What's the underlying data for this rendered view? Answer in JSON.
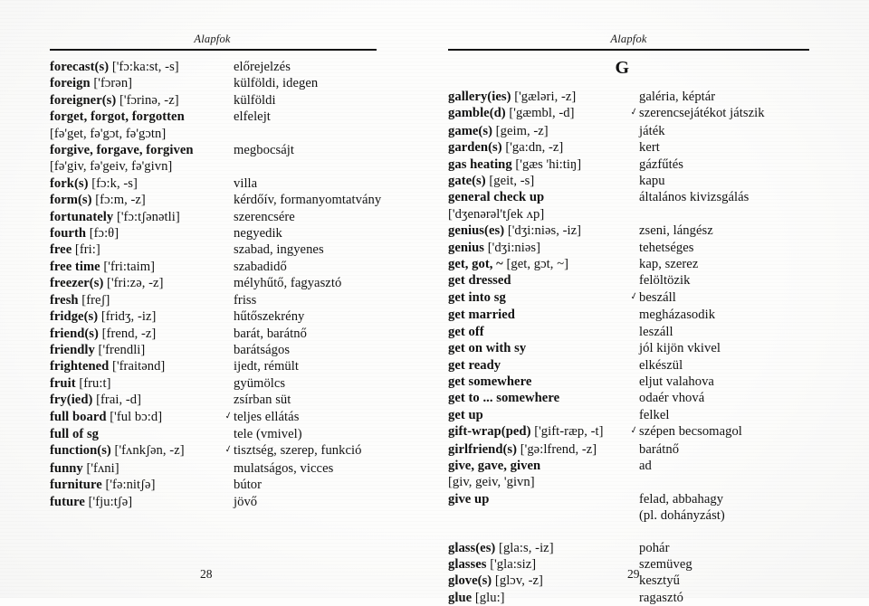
{
  "book": {
    "running_head": "Alapfok"
  },
  "left_page": {
    "running_head": "Alapfok",
    "folio": "28",
    "entries": [
      {
        "headword": "forecast(s)",
        "ipa": "['fɔ:ka:st, -s]",
        "gloss": "előrejelzés",
        "mark": ""
      },
      {
        "headword": "foreign",
        "ipa": "['fɔrən]",
        "gloss": "külföldi, idegen",
        "mark": ""
      },
      {
        "headword": "foreigner(s)",
        "ipa": "['fɔrinə, -z]",
        "gloss": "külföldi",
        "mark": ""
      },
      {
        "headword": "forget, forgot, forgotten",
        "ipa": "",
        "gloss": "elfelejt",
        "mark": ""
      },
      {
        "headword": "",
        "ipa": "[fə'get, fə'gɔt, fə'gɔtn]",
        "gloss": "",
        "mark": ""
      },
      {
        "headword": "forgive, forgave, forgiven",
        "ipa": "",
        "gloss": "megbocsájt",
        "mark": ""
      },
      {
        "headword": "",
        "ipa": "[fə'giv, fə'geiv, fə'givn]",
        "gloss": "",
        "mark": ""
      },
      {
        "headword": "fork(s)",
        "ipa": "[fɔ:k, -s]",
        "gloss": "villa",
        "mark": ""
      },
      {
        "headword": "form(s)",
        "ipa": "[fɔ:m, -z]",
        "gloss": "kérdőív, formanyomtatvány",
        "mark": ""
      },
      {
        "headword": "fortunately",
        "ipa": "['fɔ:tʃənətli]",
        "gloss": "szerencsére",
        "mark": ""
      },
      {
        "headword": "fourth",
        "ipa": "[fɔ:θ]",
        "gloss": "negyedik",
        "mark": ""
      },
      {
        "headword": "free",
        "ipa": "[fri:]",
        "gloss": "szabad, ingyenes",
        "mark": ""
      },
      {
        "headword": "free time",
        "ipa": "['fri:taim]",
        "gloss": "szabadidő",
        "mark": ""
      },
      {
        "headword": "freezer(s)",
        "ipa": "['fri:zə, -z]",
        "gloss": "mélyhűtő, fagyasztó",
        "mark": ""
      },
      {
        "headword": "fresh",
        "ipa": "[freʃ]",
        "gloss": "friss",
        "mark": ""
      },
      {
        "headword": "fridge(s)",
        "ipa": "[fridʒ, -iz]",
        "gloss": "hűtőszekrény",
        "mark": ""
      },
      {
        "headword": "friend(s)",
        "ipa": "[frend, -z]",
        "gloss": "barát, barátnő",
        "mark": ""
      },
      {
        "headword": "friendly",
        "ipa": "['frendli]",
        "gloss": "barátságos",
        "mark": ""
      },
      {
        "headword": "frightened",
        "ipa": "['fraitənd]",
        "gloss": "ijedt, rémült",
        "mark": ""
      },
      {
        "headword": "fruit",
        "ipa": "[fru:t]",
        "gloss": "gyümölcs",
        "mark": ""
      },
      {
        "headword": "fry(ied)",
        "ipa": "[frai, -d]",
        "gloss": "zsírban süt",
        "mark": ""
      },
      {
        "headword": "full board",
        "ipa": "['ful bɔ:d]",
        "gloss": "teljes ellátás",
        "mark": "✓"
      },
      {
        "headword": "full of sg",
        "ipa": "",
        "gloss": "tele (vmivel)",
        "mark": ""
      },
      {
        "headword": "function(s)",
        "ipa": "['fʌnkʃən, -z]",
        "gloss": "tisztség, szerep, funkció",
        "mark": "✓"
      },
      {
        "headword": "funny",
        "ipa": "['fʌni]",
        "gloss": "mulatságos, vicces",
        "mark": ""
      },
      {
        "headword": "furniture",
        "ipa": "['fə:nitʃə]",
        "gloss": "bútor",
        "mark": ""
      },
      {
        "headword": "future",
        "ipa": "['fju:tʃə]",
        "gloss": "jövő",
        "mark": ""
      }
    ]
  },
  "right_page": {
    "running_head": "Alapfok",
    "letter_heading": "G",
    "folio": "29",
    "entries": [
      {
        "headword": "gallery(ies)",
        "ipa": "['gæləri, -z]",
        "gloss": "galéria, képtár",
        "mark": ""
      },
      {
        "headword": "gamble(d)",
        "ipa": "['gæmbl, -d]",
        "gloss": "szerencsejátékot játszik",
        "mark": "✓"
      },
      {
        "headword": "game(s)",
        "ipa": "[geim, -z]",
        "gloss": "játék",
        "mark": ""
      },
      {
        "headword": "garden(s)",
        "ipa": "['ga:dn, -z]",
        "gloss": "kert",
        "mark": ""
      },
      {
        "headword": "gas heating",
        "ipa": "['gæs 'hi:tiŋ]",
        "gloss": "gázfűtés",
        "mark": ""
      },
      {
        "headword": "gate(s)",
        "ipa": "[geit, -s]",
        "gloss": "kapu",
        "mark": ""
      },
      {
        "headword": "general check up",
        "ipa": "",
        "gloss": "általános kivizsgálás",
        "mark": ""
      },
      {
        "headword": "",
        "ipa": "['dʒenərəl'tʃek ʌp]",
        "gloss": "",
        "mark": ""
      },
      {
        "headword": "genius(es)",
        "ipa": "['dʒi:niəs, -iz]",
        "gloss": "zseni, lángész",
        "mark": ""
      },
      {
        "headword": "genius",
        "ipa": "['dʒi:niəs]",
        "gloss": "tehetséges",
        "mark": ""
      },
      {
        "headword": "get, got, ~",
        "ipa": "[get, gɔt, ~]",
        "gloss": "kap, szerez",
        "mark": ""
      },
      {
        "headword": "get dressed",
        "ipa": "",
        "gloss": "felöltözik",
        "mark": ""
      },
      {
        "headword": "get into sg",
        "ipa": "",
        "gloss": "beszáll",
        "mark": "✓"
      },
      {
        "headword": "get married",
        "ipa": "",
        "gloss": "megházasodik",
        "mark": ""
      },
      {
        "headword": "get off",
        "ipa": "",
        "gloss": "leszáll",
        "mark": ""
      },
      {
        "headword": "get on with sy",
        "ipa": "",
        "gloss": "jól kijön vkivel",
        "mark": ""
      },
      {
        "headword": "get ready",
        "ipa": "",
        "gloss": "elkészül",
        "mark": ""
      },
      {
        "headword": "get somewhere",
        "ipa": "",
        "gloss": "eljut valahova",
        "mark": ""
      },
      {
        "headword": "get to ... somewhere",
        "ipa": "",
        "gloss": "odaér vhová",
        "mark": ""
      },
      {
        "headword": "get up",
        "ipa": "",
        "gloss": "felkel",
        "mark": ""
      },
      {
        "headword": "gift-wrap(ped)",
        "ipa": "['gift-ræp, -t]",
        "gloss": "szépen becsomagol",
        "mark": "✓"
      },
      {
        "headword": "girlfriend(s)",
        "ipa": "['gə:lfrend, -z]",
        "gloss": "barátnő",
        "mark": ""
      },
      {
        "headword": "give, gave, given",
        "ipa": "",
        "gloss": "ad",
        "mark": ""
      },
      {
        "headword": "",
        "ipa": "[giv, geiv, 'givn]",
        "gloss": "",
        "mark": ""
      },
      {
        "headword": "give up",
        "ipa": "",
        "gloss": "felad, abbahagy",
        "mark": ""
      },
      {
        "headword": "",
        "ipa": "",
        "gloss": "(pl. dohányzást)",
        "mark": ""
      },
      {
        "headword": "glass(es)",
        "ipa": "[gla:s, -iz]",
        "gloss": "pohár",
        "mark": "",
        "gap_before": true
      },
      {
        "headword": "glasses",
        "ipa": "['gla:siz]",
        "gloss": "szemüveg",
        "mark": ""
      },
      {
        "headword": "glove(s)",
        "ipa": "[glɔv, -z]",
        "gloss": "kesztyű",
        "mark": ""
      },
      {
        "headword": "glue",
        "ipa": "[glu:]",
        "gloss": "ragasztó",
        "mark": ""
      }
    ]
  }
}
